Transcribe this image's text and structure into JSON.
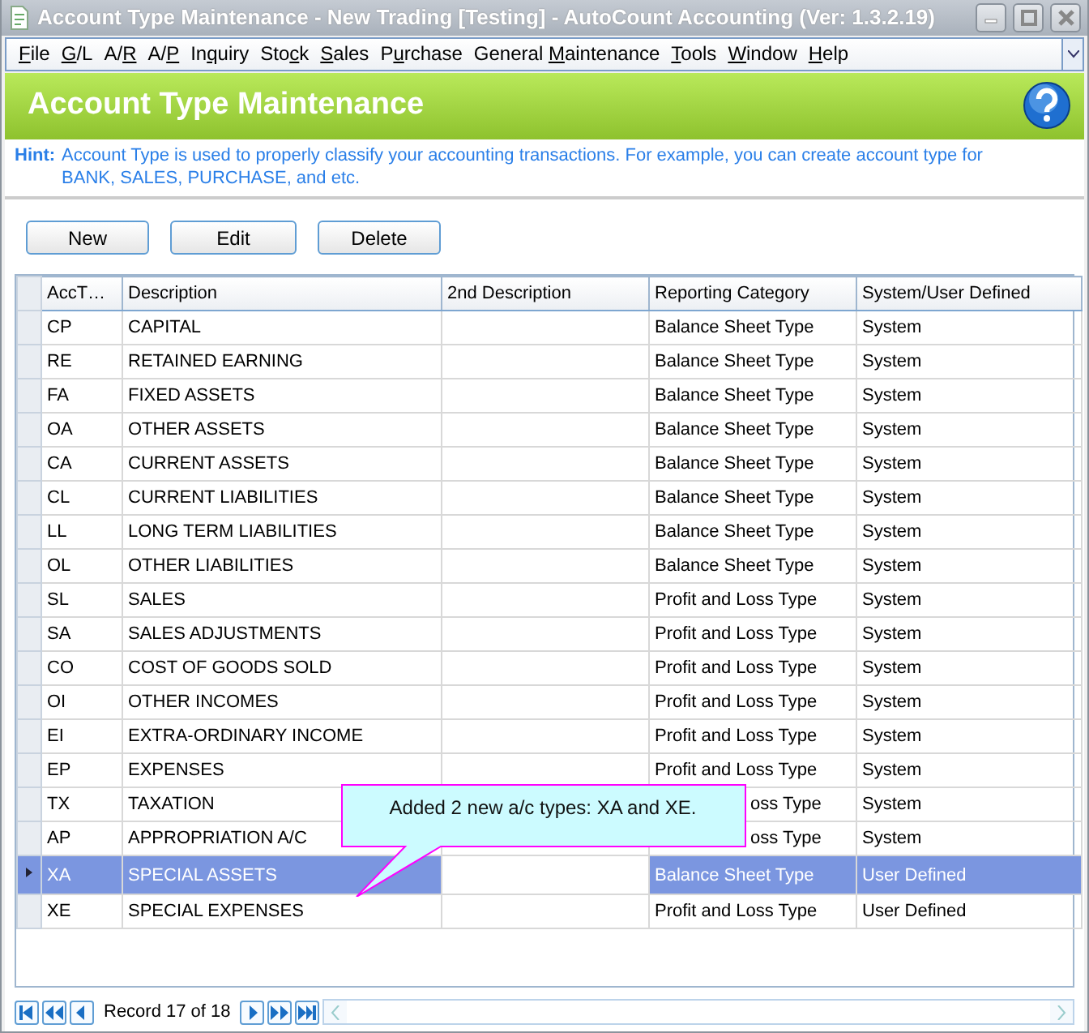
{
  "window": {
    "title": "Account Type Maintenance - New Trading  [Testing] - AutoCount Accounting (Ver: 1.3.2.19)"
  },
  "menu": [
    {
      "key": "F",
      "after": "ile"
    },
    {
      "key": "G",
      "after": "/L"
    },
    {
      "before": "A/",
      "key": "R"
    },
    {
      "before": "A/",
      "key": "P"
    },
    {
      "before": "In",
      "key": "q",
      "after": "uiry"
    },
    {
      "before": "Sto",
      "key": "c",
      "after": "k"
    },
    {
      "key": "S",
      "after": "ales"
    },
    {
      "before": "P",
      "key": "u",
      "after": "rchase"
    },
    {
      "before": "General ",
      "key": "M",
      "after": "aintenance"
    },
    {
      "key": "T",
      "after": "ools"
    },
    {
      "key": "W",
      "after": "indow"
    },
    {
      "key": "H",
      "after": "elp"
    }
  ],
  "header": {
    "title": "Account Type Maintenance"
  },
  "hint": {
    "label": "Hint:",
    "text": "Account Type is used to properly classify your accounting transactions. For example, you can create account type for BANK, SALES, PURCHASE, and etc."
  },
  "buttons": [
    "New",
    "Edit",
    "Delete"
  ],
  "table": {
    "columns": [
      {
        "label": "AccT…",
        "focused": false
      },
      {
        "label": "Description",
        "focused": false
      },
      {
        "label": "2nd Description",
        "focused": true
      },
      {
        "label": "Reporting Category",
        "focused": false
      },
      {
        "label": "System/User Defined",
        "focused": false
      }
    ],
    "rows": [
      {
        "code": "CP",
        "description": "CAPITAL",
        "category": "Balance Sheet Type",
        "defined": "System",
        "selected": false,
        "covered": false
      },
      {
        "code": "RE",
        "description": "RETAINED EARNING",
        "category": "Balance Sheet Type",
        "defined": "System",
        "selected": false,
        "covered": false
      },
      {
        "code": "FA",
        "description": "FIXED ASSETS",
        "category": "Balance Sheet Type",
        "defined": "System",
        "selected": false,
        "covered": false
      },
      {
        "code": "OA",
        "description": "OTHER ASSETS",
        "category": "Balance Sheet Type",
        "defined": "System",
        "selected": false,
        "covered": false
      },
      {
        "code": "CA",
        "description": "CURRENT ASSETS",
        "category": "Balance Sheet Type",
        "defined": "System",
        "selected": false,
        "covered": false
      },
      {
        "code": "CL",
        "description": "CURRENT LIABILITIES",
        "category": "Balance Sheet Type",
        "defined": "System",
        "selected": false,
        "covered": false
      },
      {
        "code": "LL",
        "description": "LONG TERM LIABILITIES",
        "category": "Balance Sheet Type",
        "defined": "System",
        "selected": false,
        "covered": false
      },
      {
        "code": "OL",
        "description": "OTHER LIABILITIES",
        "category": "Balance Sheet Type",
        "defined": "System",
        "selected": false,
        "covered": false
      },
      {
        "code": "SL",
        "description": "SALES",
        "category": "Profit and Loss Type",
        "defined": "System",
        "selected": false,
        "covered": false
      },
      {
        "code": "SA",
        "description": "SALES ADJUSTMENTS",
        "category": "Profit and Loss Type",
        "defined": "System",
        "selected": false,
        "covered": false
      },
      {
        "code": "CO",
        "description": "COST OF GOODS SOLD",
        "category": "Profit and Loss Type",
        "defined": "System",
        "selected": false,
        "covered": false
      },
      {
        "code": "OI",
        "description": "OTHER INCOMES",
        "category": "Profit and Loss Type",
        "defined": "System",
        "selected": false,
        "covered": false
      },
      {
        "code": "EI",
        "description": "EXTRA-ORDINARY INCOME",
        "category": "Profit and Loss Type",
        "defined": "System",
        "selected": false,
        "covered": false
      },
      {
        "code": "EP",
        "description": "EXPENSES",
        "category": "Profit and Loss Type",
        "defined": "System",
        "selected": false,
        "covered": false
      },
      {
        "code": "TX",
        "description": "TAXATION",
        "category": "oss Type",
        "defined": "System",
        "selected": false,
        "covered": true
      },
      {
        "code": "AP",
        "description": "APPROPRIATION A/C",
        "category": "oss Type",
        "defined": "System",
        "selected": false,
        "covered": true
      },
      {
        "code": "XA",
        "description": "SPECIAL ASSETS",
        "category": "Balance Sheet Type",
        "defined": "User Defined",
        "selected": true,
        "covered": false
      },
      {
        "code": "XE",
        "description": "SPECIAL EXPENSES",
        "category": "Profit and Loss Type",
        "defined": "User Defined",
        "selected": false,
        "covered": false
      }
    ]
  },
  "callout": {
    "text": "Added 2 new a/c types: XA and XE."
  },
  "navigator": {
    "record": "Record 17 of 18"
  }
}
